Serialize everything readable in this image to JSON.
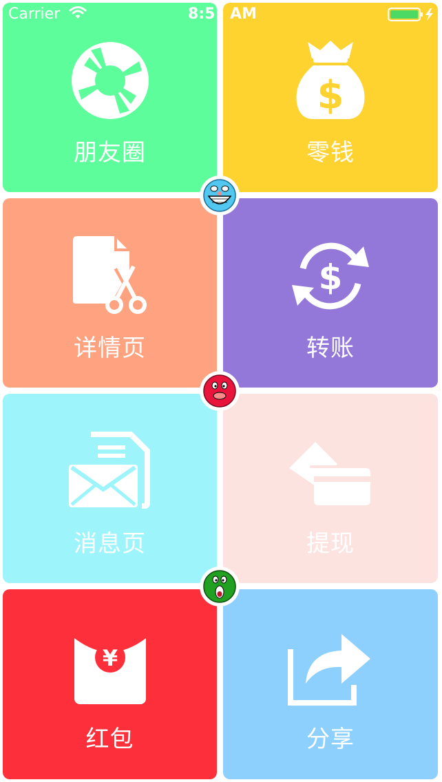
{
  "status_bar": {
    "carrier": "Carrier",
    "time_hm": "8:5",
    "time_ampm": "AM",
    "wifi_icon": "wifi-icon",
    "battery_icon": "battery-charging-icon",
    "battery_color": "#4cd964"
  },
  "tiles": [
    {
      "label": "朋友圈",
      "icon": "camera-aperture-icon",
      "color": "#5efd9b"
    },
    {
      "label": "零钱",
      "icon": "money-bag-icon",
      "color": "#fed330"
    },
    {
      "label": "详情页",
      "icon": "document-scissors-icon",
      "color": "#fea280"
    },
    {
      "label": "转账",
      "icon": "dollar-refresh-icon",
      "color": "#9478d9"
    },
    {
      "label": "消息页",
      "icon": "envelope-document-icon",
      "color": "#9ef4fb"
    },
    {
      "label": "提现",
      "icon": "card-wallet-icon",
      "color": "#fde3df"
    },
    {
      "label": "红包",
      "icon": "red-envelope-yen-icon",
      "color": "#fd2f3a"
    },
    {
      "label": "分享",
      "icon": "share-arrow-icon",
      "color": "#8dd0fd"
    }
  ],
  "emoji_badges": [
    {
      "icon": "laughing-blue-face-icon",
      "color": "#52c8f0"
    },
    {
      "icon": "red-face-icon",
      "color": "#e8143c"
    },
    {
      "icon": "green-face-icon",
      "color": "#22a022"
    }
  ]
}
